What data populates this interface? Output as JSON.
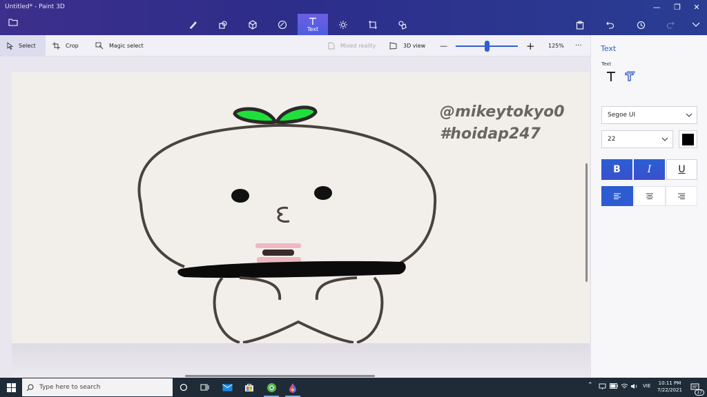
{
  "window": {
    "title": "Untitled* - Paint 3D",
    "controls": [
      "minimize",
      "restore",
      "close"
    ]
  },
  "toolbar": {
    "tools": [
      {
        "name": "brushes",
        "icon": "brush-icon"
      },
      {
        "name": "2d-shapes",
        "icon": "shapes-2d-icon"
      },
      {
        "name": "3d-shapes",
        "icon": "cube-icon"
      },
      {
        "name": "stickers",
        "icon": "sticker-icon"
      },
      {
        "name": "text",
        "icon": "text-icon",
        "label": "Text",
        "active": true
      },
      {
        "name": "effects",
        "icon": "effects-sun-icon"
      },
      {
        "name": "canvas",
        "icon": "canvas-crop-icon"
      },
      {
        "name": "3d-library",
        "icon": "library-icon"
      }
    ],
    "right": [
      "paste-icon",
      "undo-icon",
      "history-icon",
      "redo-icon",
      "expand-chevron-icon"
    ]
  },
  "subtoolbar": {
    "select_label": "Select",
    "crop_label": "Crop",
    "magic_select_label": "Magic select",
    "mixed_reality_label": "Mixed reality",
    "view3d_label": "3D view",
    "zoom_label": "125%",
    "zoom_fraction": 0.5,
    "more": "···"
  },
  "canvas": {
    "watermark_line1": "@mikeytokyo0",
    "watermark_line2": "#hoidap247"
  },
  "panel": {
    "title": "Text",
    "subtitle": "Text",
    "font": "Segoe UI",
    "size": "22",
    "color": "#000000",
    "bold_label": "B",
    "italic_label": "I",
    "underline_label": "U",
    "bold": true,
    "italic": true,
    "underline": false,
    "alignment": "left"
  },
  "taskbar": {
    "search_placeholder": "Type here to search",
    "language": "VIE",
    "time": "10:11 PM",
    "date": "7/22/2021",
    "notification_count": "17"
  },
  "colors": {
    "accent": "#2d5bd1",
    "titlebar": "#2d2d8a",
    "taskbar": "#1f2c38"
  }
}
